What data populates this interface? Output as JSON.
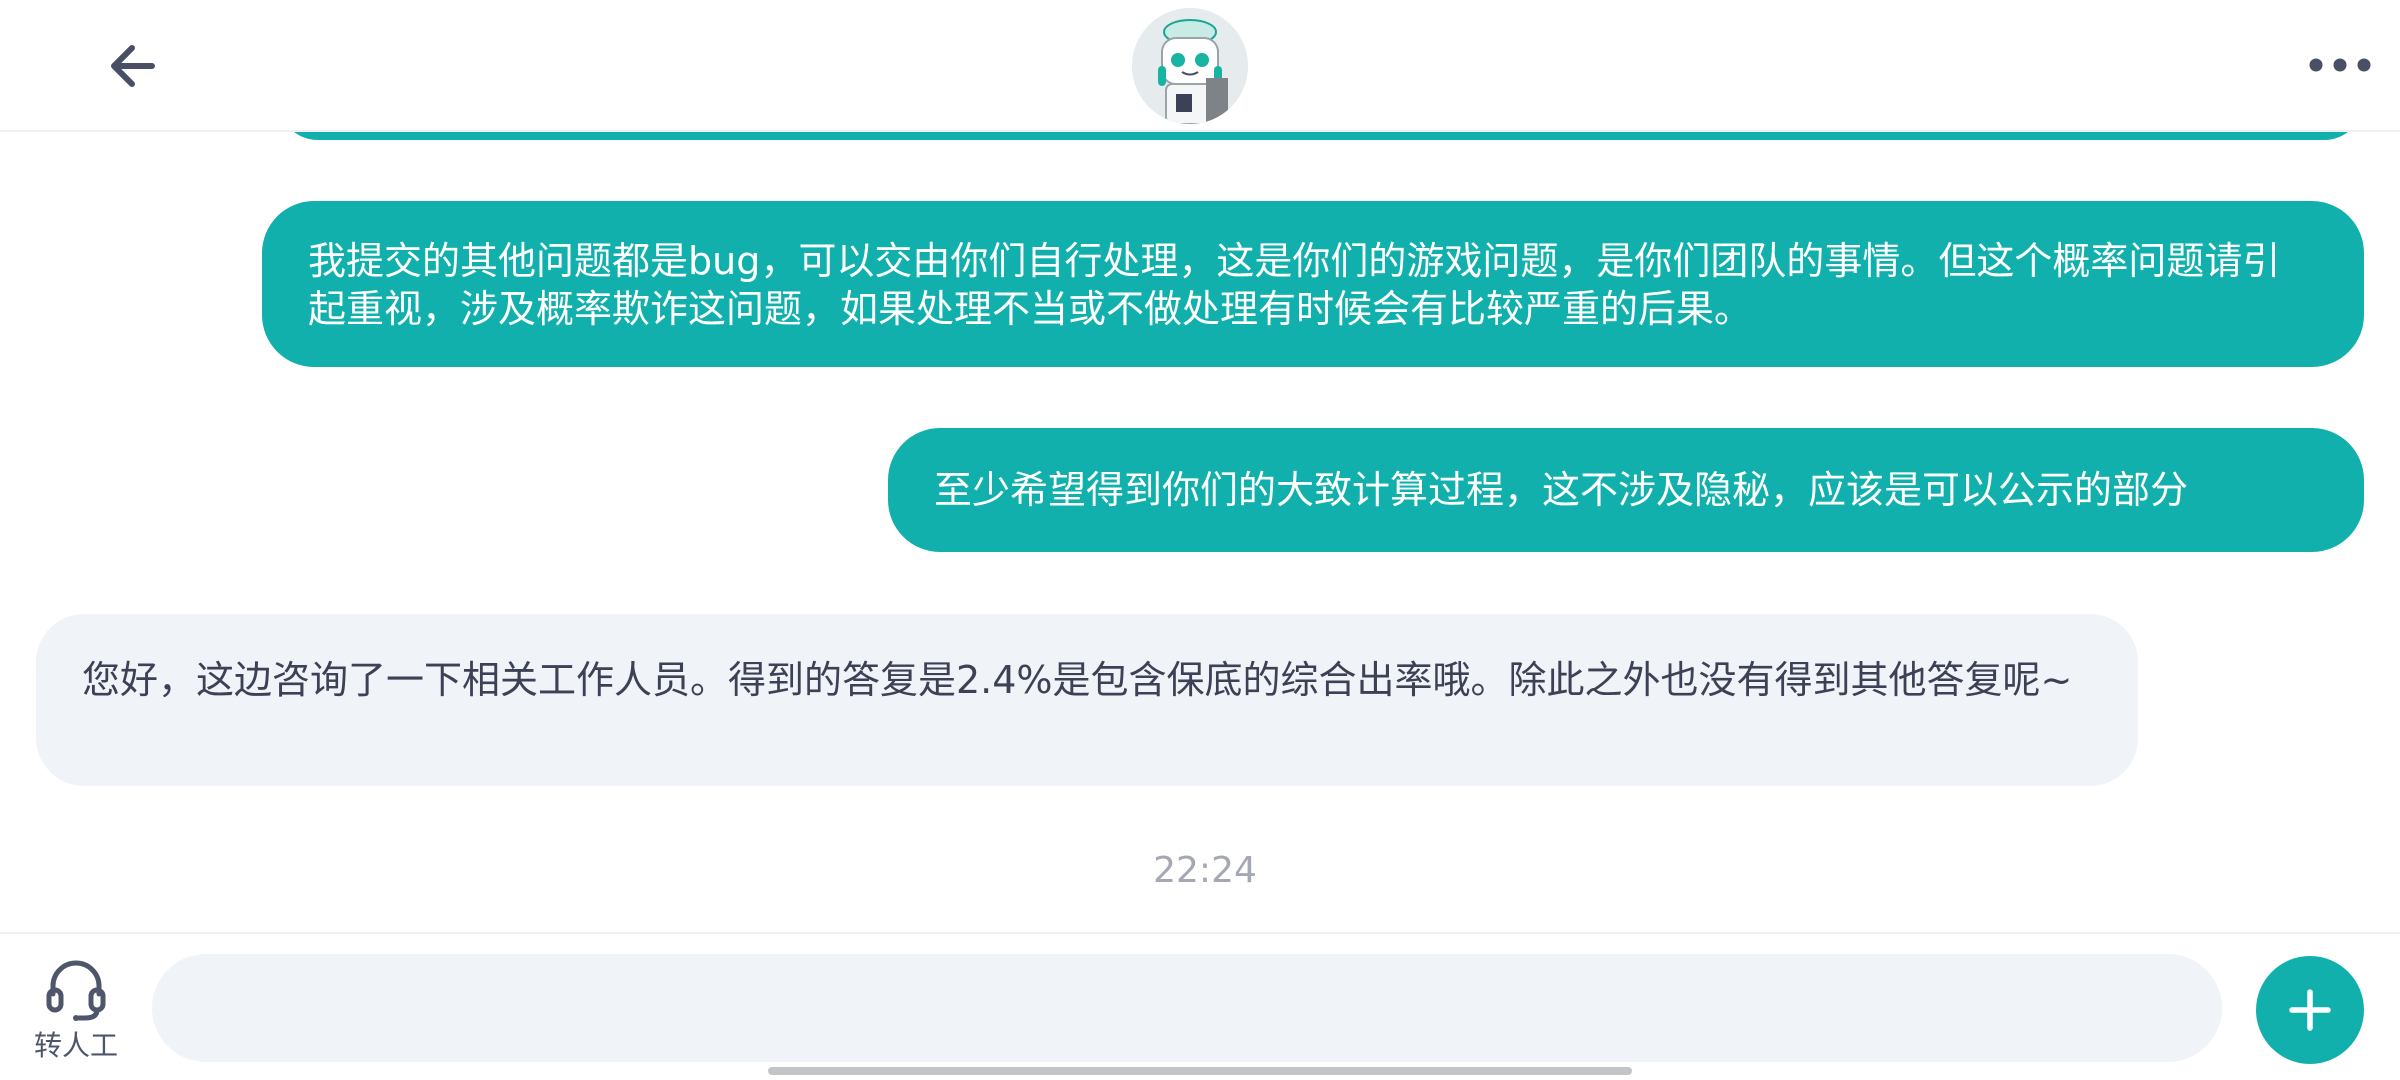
{
  "header": {
    "back_icon": "arrow-left-icon",
    "avatar_icon": "bot-avatar-icon",
    "more_icon": "more-dots-icon"
  },
  "messages": [
    {
      "role": "user",
      "text": "我提交的其他问题都是bug，可以交由你们自行处理，这是你们的游戏问题，是你们团队的事情。但这个概率问题请引起重视，涉及概率欺诈这问题，如果处理不当或不做处理有时候会有比较严重的后果。"
    },
    {
      "role": "user",
      "text": "至少希望得到你们的大致计算过程，这不涉及隐秘，应该是可以公示的部分"
    },
    {
      "role": "agent",
      "text": "您好，这边咨询了一下相关工作人员。得到的答复是2.4%是包含保底的综合出率哦。除此之外也没有得到其他答复呢~"
    }
  ],
  "timestamp": "22:24",
  "bottom_bar": {
    "agent_label": "转人工",
    "agent_icon": "headset-icon",
    "input_value": "",
    "plus_icon": "plus-icon"
  },
  "colors": {
    "accent": "#12b0ad",
    "incoming_bubble": "#f0f3f7",
    "incoming_text": "#3d4155",
    "timestamp": "#a4a8b2"
  }
}
